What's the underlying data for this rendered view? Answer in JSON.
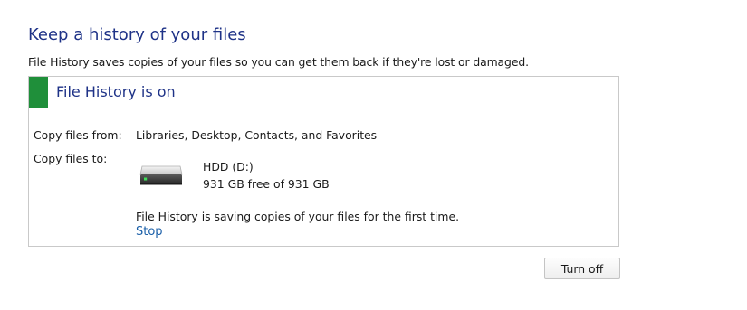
{
  "page": {
    "title": "Keep a history of your files",
    "description": "File History saves copies of your files so you can get them back if they're lost or damaged."
  },
  "status": {
    "title": "File History is on",
    "indicator_color": "#1f8f3a"
  },
  "copy_from": {
    "label": "Copy files from:",
    "value": "Libraries, Desktop, Contacts, and Favorites"
  },
  "copy_to": {
    "label": "Copy files to:",
    "drive_icon": "hard-drive-icon",
    "drive_name": "HDD (D:)",
    "drive_space": "931 GB free of 931 GB"
  },
  "progress": {
    "message": "File History is saving copies of your files for the first time.",
    "stop_label": "Stop"
  },
  "actions": {
    "turn_off_label": "Turn off"
  },
  "colors": {
    "heading": "#1e3287",
    "link": "#1a5fa8",
    "status_green": "#1f8f3a",
    "drive_led": "#3fe05a"
  }
}
